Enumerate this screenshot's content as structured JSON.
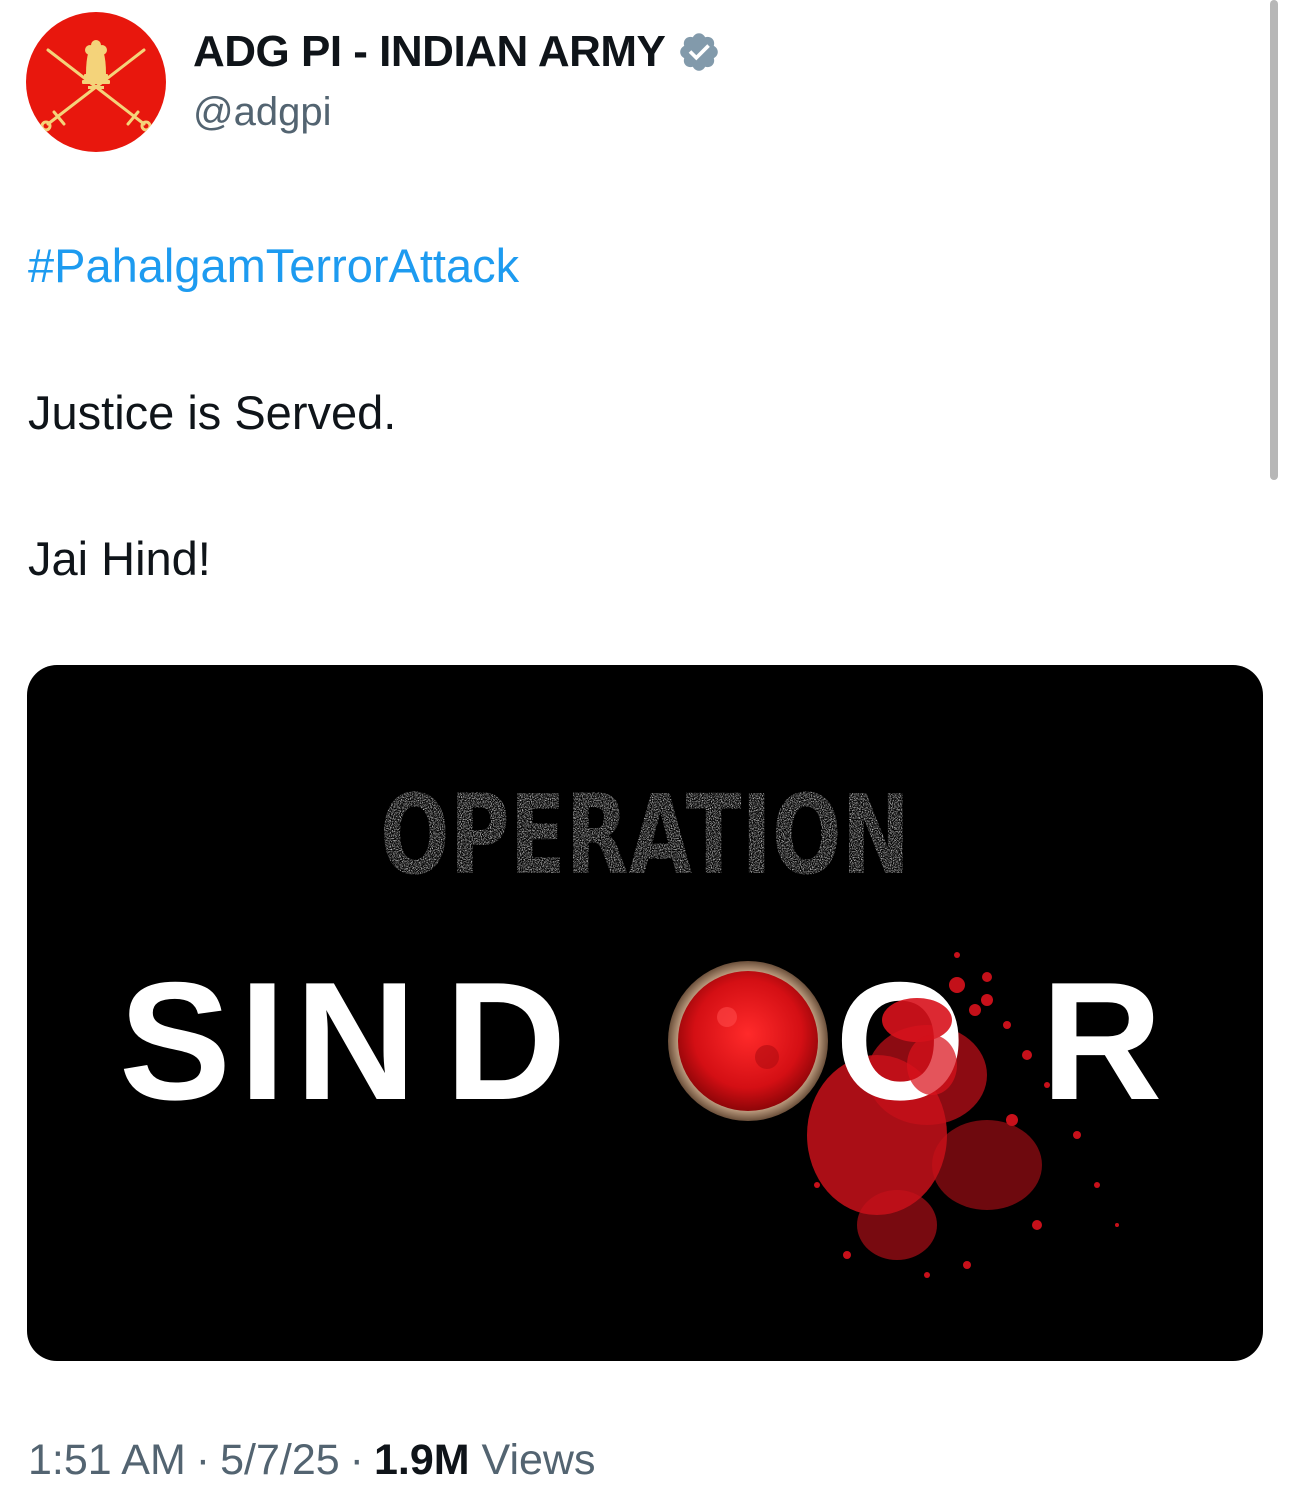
{
  "tweet": {
    "author": {
      "display_name": "ADG PI - INDIAN ARMY",
      "handle": "@adgpi",
      "verified": true,
      "avatar_icon": "indian-army-crest-icon",
      "avatar_color": "#e8170d"
    },
    "hashtag": "#PahalgamTerrorAttack",
    "lines": [
      "Justice is Served.",
      "Jai Hind!"
    ],
    "media": {
      "title_top": "OPERATION",
      "title_letters": [
        "S",
        "I",
        "N",
        "D",
        "O",
        "R"
      ]
    },
    "time": "1:51 AM",
    "separator": "·",
    "date": "5/7/25",
    "views_count": "1.9M",
    "views_label": "Views"
  },
  "colors": {
    "link": "#1d9bf0",
    "text": "#0f1419",
    "secondary": "#536471",
    "sindoor_red": "#d9121c"
  }
}
